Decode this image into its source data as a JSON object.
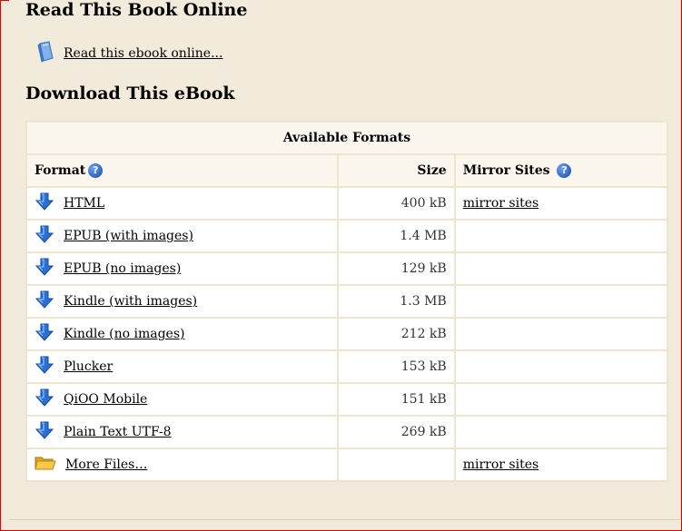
{
  "read_section": {
    "title": "Read This Book Online",
    "link": "Read this ebook online..."
  },
  "download_section": {
    "title": "Download This eBook",
    "table_caption": "Available Formats",
    "columns": {
      "format": "Format",
      "size": "Size",
      "mirror": "Mirror Sites"
    },
    "help_icon_glyph": "?",
    "rows": [
      {
        "format": "HTML",
        "size": "400 kB",
        "mirror": "mirror sites",
        "icon": "download-arrow-icon"
      },
      {
        "format": "EPUB (with images)",
        "size": "1.4 MB",
        "mirror": "",
        "icon": "download-arrow-icon"
      },
      {
        "format": "EPUB (no images)",
        "size": "129 kB",
        "mirror": "",
        "icon": "download-arrow-icon"
      },
      {
        "format": "Kindle (with images)",
        "size": "1.3 MB",
        "mirror": "",
        "icon": "download-arrow-icon"
      },
      {
        "format": "Kindle (no images)",
        "size": "212 kB",
        "mirror": "",
        "icon": "download-arrow-icon"
      },
      {
        "format": "Plucker",
        "size": "153 kB",
        "mirror": "",
        "icon": "download-arrow-icon"
      },
      {
        "format": "QiOO Mobile",
        "size": "151 kB",
        "mirror": "",
        "icon": "download-arrow-icon"
      },
      {
        "format": "Plain Text UTF-8",
        "size": "269 kB",
        "mirror": "",
        "icon": "download-arrow-icon"
      },
      {
        "format": "More Files…",
        "size": "",
        "mirror": "mirror sites",
        "icon": "folder-icon"
      }
    ]
  },
  "colors": {
    "page_bg": "#f2eadb",
    "frame_red": "#e00000",
    "table_border": "#efe4cc",
    "header_bg": "#fbf7ee",
    "icon_blue": "#2a6fd6"
  }
}
